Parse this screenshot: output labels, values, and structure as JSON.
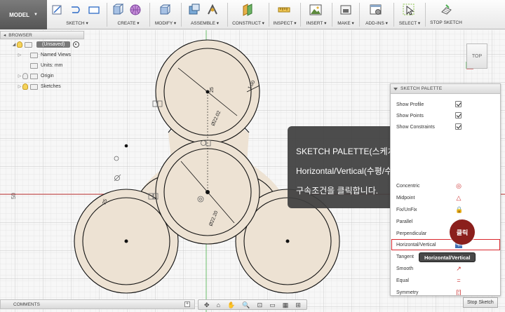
{
  "toolbar": {
    "mode": "MODEL",
    "groups": {
      "sketch": "SKETCH",
      "create": "CREATE",
      "modify": "MODIFY",
      "assemble": "ASSEMBLE",
      "construct": "CONSTRUCT",
      "inspect": "INSPECT",
      "insert": "INSERT",
      "make": "MAKE",
      "addins": "ADD-INS",
      "select": "SELECT",
      "stop_sketch": "STOP SKETCH"
    }
  },
  "browser": {
    "title": "BROWSER",
    "root": "(Unsaved)",
    "items": [
      "Named Views",
      "Units: mm",
      "Origin",
      "Sketches"
    ]
  },
  "canvas": {
    "dimensions": [
      "25",
      "Ø22.02",
      "Ø22.20",
      "1.00",
      "25"
    ],
    "axis_label": "50"
  },
  "viewcube": {
    "face": "TOP"
  },
  "palette": {
    "title": "SKETCH PALETTE",
    "rows": [
      {
        "label": "Show Profile",
        "icon": "checkbox-checked"
      },
      {
        "label": "Show Points",
        "icon": "checkbox-checked"
      },
      {
        "label": "Show Constraints",
        "icon": "checkbox-checked"
      },
      {
        "label": "Concentric",
        "icon": "concentric-icon"
      },
      {
        "label": "Midpoint",
        "icon": "midpoint-icon"
      },
      {
        "label": "Fix/UnFix",
        "icon": "lock-icon"
      },
      {
        "label": "Parallel",
        "icon": "parallel-icon"
      },
      {
        "label": "Perpendicular",
        "icon": "perpendicular-icon"
      },
      {
        "label": "Horizontal/Vertical",
        "icon": "horizontal-vertical-icon"
      },
      {
        "label": "Tangent",
        "icon": "tangent-icon"
      },
      {
        "label": "Smooth",
        "icon": "smooth-icon"
      },
      {
        "label": "Equal",
        "icon": "equal-icon"
      },
      {
        "label": "Symmetry",
        "icon": "symmetry-icon"
      }
    ],
    "tooltip": "Horizontal/Vertical",
    "click_badge": "클릭",
    "stop_sketch": "Stop Sketch"
  },
  "callout": {
    "line1": "SKETCH PALETTE(스케치 팔레트)에서",
    "line2": "Horizontal/Vertical(수평/수직)",
    "line3": "구속조건을 클릭합니다."
  },
  "comments": {
    "label": "COMMENTS"
  },
  "colors": {
    "sketch_fill": "#ede2d3",
    "sketch_line": "#111111",
    "grid_major": "#c9c9c9",
    "grid_minor": "#e2e2e2",
    "x_axis": "#d04040",
    "y_axis": "#5ab55a",
    "highlight": "#d9262c",
    "badge": "#8b1f1c"
  }
}
